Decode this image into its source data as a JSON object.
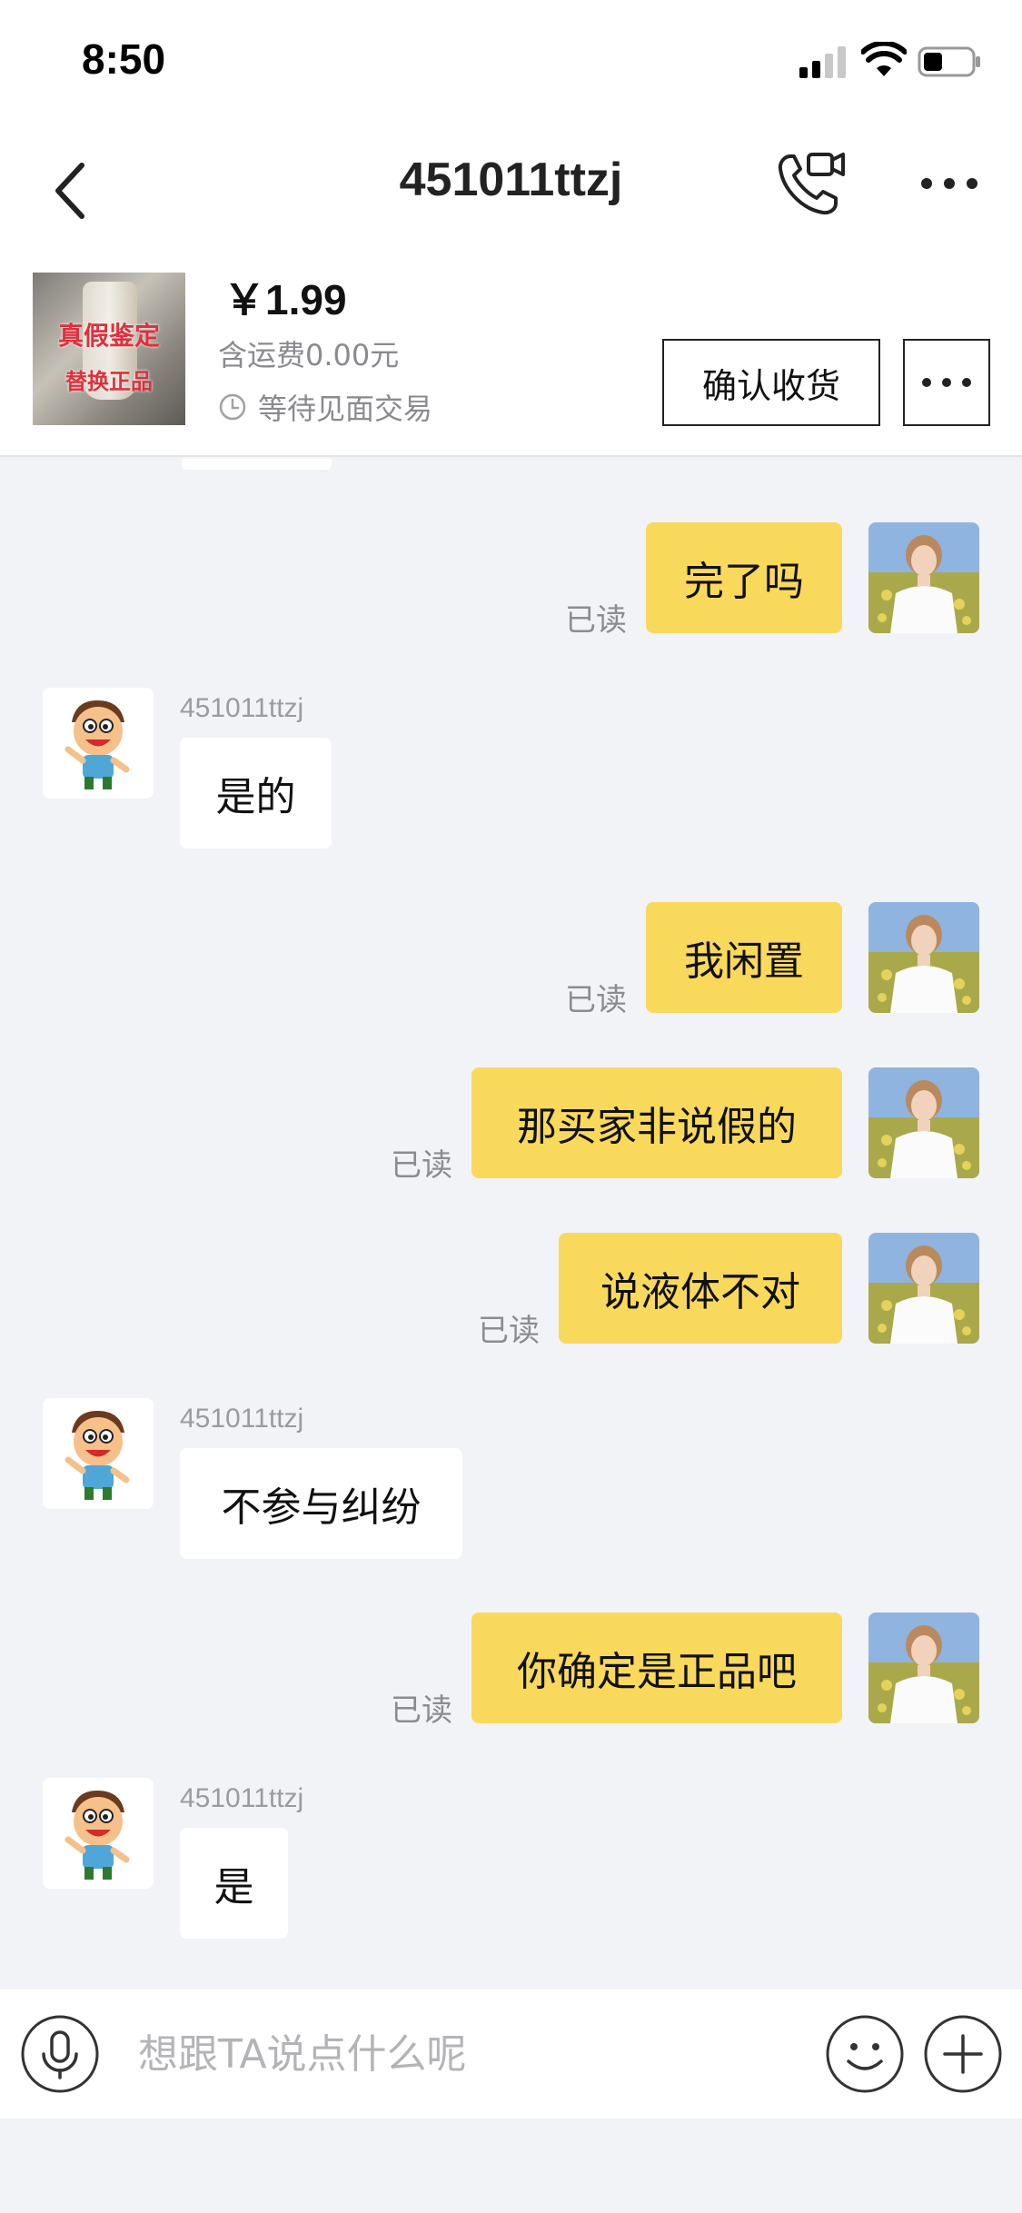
{
  "status_bar": {
    "time": "8:50"
  },
  "nav": {
    "title": "451011ttzj"
  },
  "product": {
    "thumbnail_text_1": "真假鉴定",
    "thumbnail_text_2": "替换正品",
    "price": "￥1.99",
    "shipping": "含运费0.00元",
    "status": "等待见面交易",
    "confirm_label": "确认收货"
  },
  "messages": [
    {
      "side": "mine",
      "text": "完了吗",
      "read": "已读"
    },
    {
      "side": "theirs",
      "sender": "451011ttzj",
      "text": "是的"
    },
    {
      "side": "mine",
      "text": "我闲置",
      "read": "已读"
    },
    {
      "side": "mine",
      "text": "那买家非说假的",
      "read": "已读"
    },
    {
      "side": "mine",
      "text": "说液体不对",
      "read": "已读"
    },
    {
      "side": "theirs",
      "sender": "451011ttzj",
      "text": "不参与纠纷"
    },
    {
      "side": "mine",
      "text": "你确定是正品吧",
      "read": "已读"
    },
    {
      "side": "theirs",
      "sender": "451011ttzj",
      "text": "是"
    }
  ],
  "input": {
    "placeholder": "想跟TA说点什么呢"
  },
  "colors": {
    "accent_yellow": "#f9d95c",
    "background": "#f2f3f7",
    "read_label": "#8c8c90"
  },
  "icons": [
    "back-icon",
    "video-call-icon",
    "more-icon",
    "clock-icon",
    "microphone-icon",
    "emoji-icon",
    "plus-icon"
  ]
}
